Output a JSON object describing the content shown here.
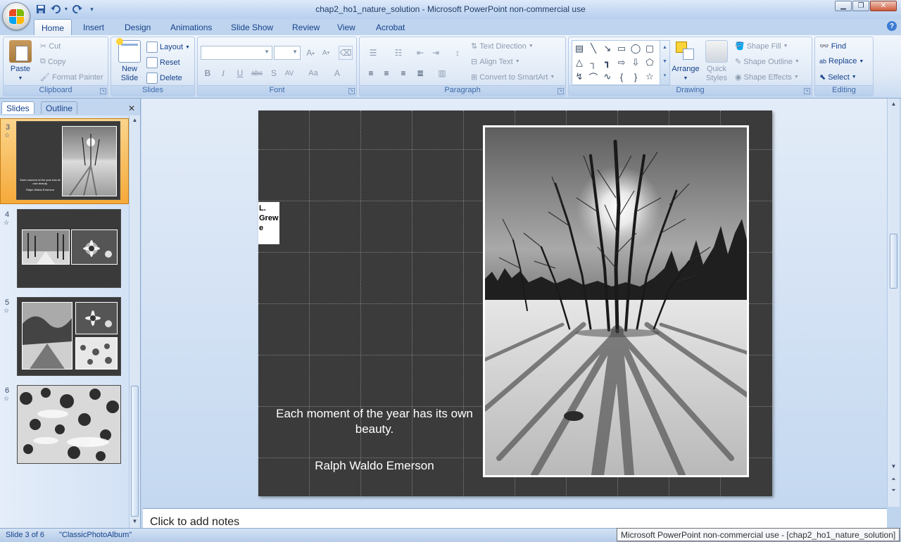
{
  "window": {
    "title": "chap2_ho1_nature_solution - Microsoft PowerPoint non-commercial use",
    "controls": [
      "minimize",
      "restore",
      "close"
    ]
  },
  "quick_access": [
    "save-icon",
    "undo-icon",
    "undo-dropdown-icon",
    "redo-icon",
    "customize-icon"
  ],
  "tabs": [
    {
      "label": "Home",
      "active": true
    },
    {
      "label": "Insert"
    },
    {
      "label": "Design"
    },
    {
      "label": "Animations"
    },
    {
      "label": "Slide Show"
    },
    {
      "label": "Review"
    },
    {
      "label": "View"
    },
    {
      "label": "Acrobat"
    }
  ],
  "ribbon": {
    "clipboard": {
      "label": "Clipboard",
      "paste": "Paste",
      "cut": "Cut",
      "copy": "Copy",
      "format_painter": "Format Painter"
    },
    "slides": {
      "label": "Slides",
      "new_slide": "New Slide",
      "layout": "Layout",
      "reset": "Reset",
      "delete": "Delete"
    },
    "font": {
      "label": "Font",
      "font_name": "",
      "font_size": ""
    },
    "paragraph": {
      "label": "Paragraph",
      "text_direction": "Text Direction",
      "align_text": "Align Text",
      "convert_smartart": "Convert to SmartArt"
    },
    "drawing": {
      "label": "Drawing",
      "arrange": "Arrange",
      "quick_styles": "Quick Styles",
      "shape_fill": "Shape Fill",
      "shape_outline": "Shape Outline",
      "shape_effects": "Shape Effects"
    },
    "editing": {
      "label": "Editing",
      "find": "Find",
      "replace": "Replace",
      "select": "Select"
    }
  },
  "panel": {
    "tabs": [
      "Slides",
      "Outline"
    ],
    "slides": [
      {
        "number": "3",
        "selected": true,
        "caption": "Each moment of the year has its own beauty.",
        "author": "Ralph Waldo Emerson"
      },
      {
        "number": "4"
      },
      {
        "number": "5"
      },
      {
        "number": "6"
      }
    ]
  },
  "slide": {
    "author_box": "L. Grewe",
    "quote": "Each moment of the year has its own beauty.",
    "quote_author": "Ralph Waldo Emerson"
  },
  "notes": {
    "placeholder": "Click to add notes"
  },
  "status": {
    "slide_position": "Slide 3 of 6",
    "theme": "\"ClassicPhotoAlbum\"",
    "tooltip": "Microsoft PowerPoint non-commercial use - [chap2_ho1_nature_solution]"
  },
  "colors": {
    "accent": "#15428b",
    "selected_thumb": "#f5a93a",
    "slide_bg": "#3b3b3b"
  }
}
